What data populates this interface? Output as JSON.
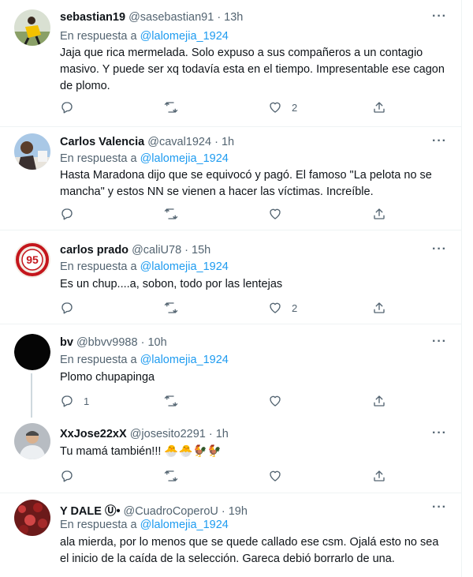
{
  "tweets": [
    {
      "name": "sebastian19",
      "handle": "@sasebastian91 · 13h",
      "reply_prefix": "En respuesta a",
      "reply_to": "@lalomejia_1924",
      "text": "Jaja que rica mermelada. Solo expuso a sus compañeros a un contagio masivo. Y puede ser xq todavía esta en el tiempo. Impresentable ese cagon de plomo.",
      "reply_count": "",
      "like_count": "2"
    },
    {
      "name": "Carlos Valencia",
      "handle": "@caval1924 · 1h",
      "reply_prefix": "En respuesta a",
      "reply_to": "@lalomejia_1924",
      "text": "Hasta Maradona dijo que se equivocó y pagó. El famoso \"La pelota no se mancha\" y estos NN se vienen a hacer las víctimas. Increíble.",
      "reply_count": "",
      "like_count": ""
    },
    {
      "name": "carlos prado",
      "handle": "@caliU78 · 15h",
      "reply_prefix": "En respuesta a",
      "reply_to": "@lalomejia_1924",
      "text": "Es un chup....a, sobon, todo por las lentejas",
      "reply_count": "",
      "like_count": "2"
    },
    {
      "name": "bv",
      "handle": "@bbvv9988 · 10h",
      "reply_prefix": "En respuesta a",
      "reply_to": "@lalomejia_1924",
      "text": "Plomo chupapinga",
      "reply_count": "1",
      "like_count": ""
    },
    {
      "name": "XxJose22xX",
      "handle": "@josesito2291 · 1h",
      "reply_prefix": "",
      "reply_to": "",
      "text": "Tu mamá también!!! 🐣🐣🐓🐓",
      "reply_count": "",
      "like_count": ""
    },
    {
      "name": "Y DALE Ⓤ•",
      "handle": "@CuadroCoperoU · 19h",
      "reply_prefix": "En respuesta a",
      "reply_to": "@lalomejia_1924",
      "text": "ala mierda, por lo menos que se quede callado ese csm. Ojalá esto no sea el inicio de la caída de la selección. Gareca debió borrarlo de una.",
      "reply_count": "",
      "like_count": ""
    }
  ],
  "more_glyph": "···",
  "avatar_badge_text": "95",
  "colors": {
    "text": "#0f1419",
    "secondary": "#536471",
    "link": "#1d9bf0",
    "divider": "#eff3f4"
  }
}
